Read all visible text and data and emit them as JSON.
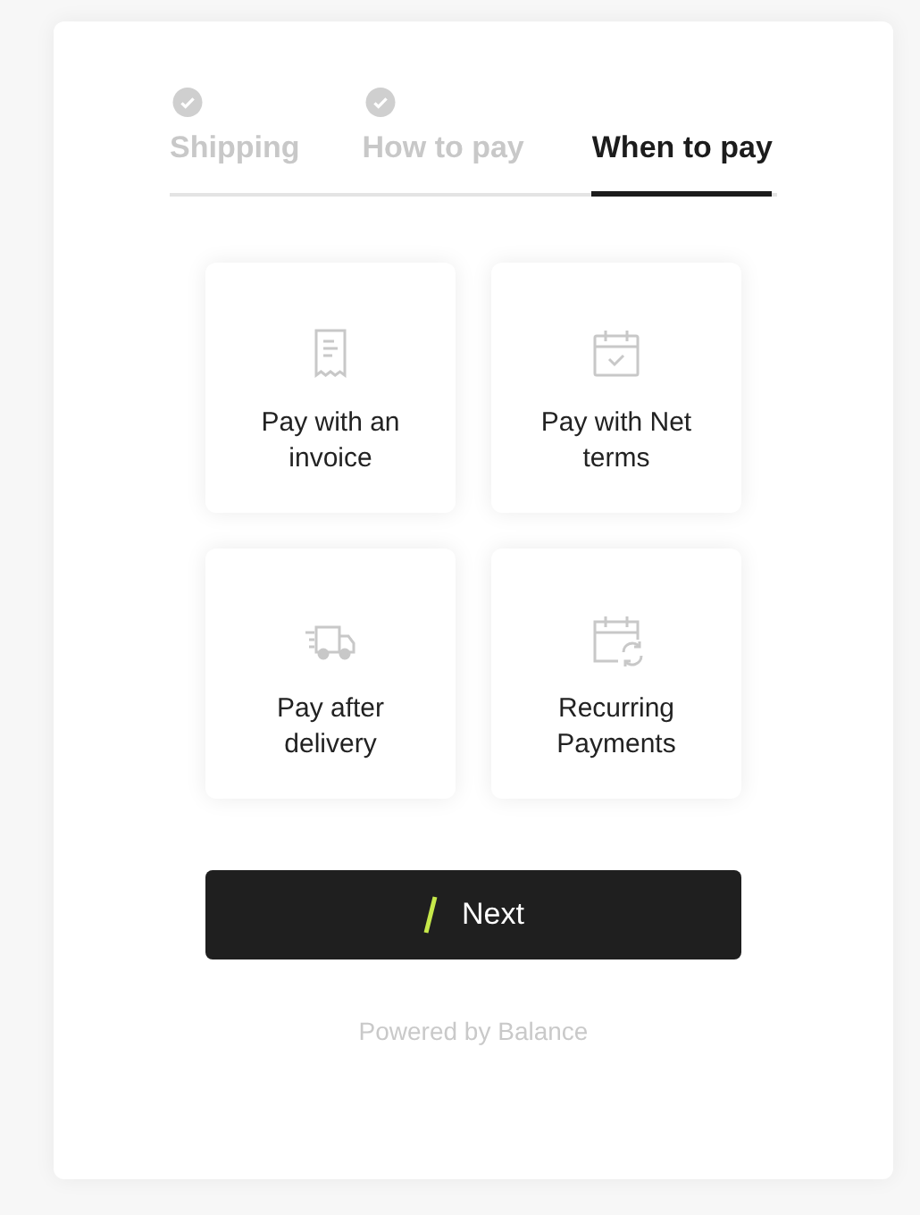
{
  "steps": [
    {
      "label": "Shipping",
      "completed": true,
      "selected": false
    },
    {
      "label": "How to pay",
      "completed": true,
      "selected": false
    },
    {
      "label": "When to pay",
      "completed": false,
      "selected": true
    }
  ],
  "options": [
    {
      "kind": "invoice",
      "label": "Pay with an invoice"
    },
    {
      "kind": "calendar",
      "label": "Pay with Net terms"
    },
    {
      "kind": "truck",
      "label": "Pay after delivery"
    },
    {
      "kind": "recurring",
      "label": "Recurring Payments"
    }
  ],
  "next_button": {
    "label": "Next"
  },
  "footer": "Powered by Balance"
}
